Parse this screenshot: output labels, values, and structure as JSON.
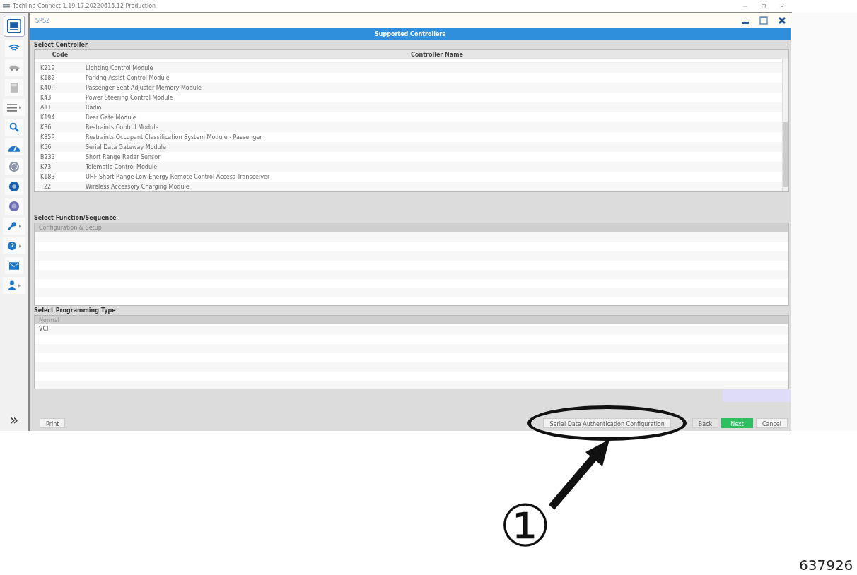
{
  "window": {
    "title": "Techline Connect 1.19.17.20220615.12 Production"
  },
  "app": {
    "title": "SPS2",
    "banner": "Supported Controllers"
  },
  "sidebar": {
    "items": [
      {
        "kind": "logo"
      },
      {
        "kind": "wifi",
        "menu": false
      },
      {
        "kind": "car",
        "menu": false
      },
      {
        "kind": "device",
        "menu": false
      },
      {
        "kind": "list",
        "menu": true
      },
      {
        "kind": "search",
        "menu": false
      },
      {
        "kind": "gauge",
        "menu": false
      },
      {
        "kind": "globe",
        "menu": false
      },
      {
        "kind": "si",
        "menu": false
      },
      {
        "kind": "disc",
        "menu": false
      },
      {
        "kind": "wrench",
        "menu": true
      },
      {
        "kind": "help",
        "menu": true
      },
      {
        "kind": "mail",
        "menu": false
      },
      {
        "kind": "user",
        "menu": true
      }
    ],
    "expand": "»"
  },
  "controllers": {
    "label": "Select Controller",
    "columns": [
      "Code",
      "Controller Name"
    ],
    "rows": [
      {
        "code": "K219",
        "name": "Lighting Control Module"
      },
      {
        "code": "K182",
        "name": "Parking Assist Control Module"
      },
      {
        "code": "K40P",
        "name": "Passenger Seat Adjuster Memory Module"
      },
      {
        "code": "K43",
        "name": "Power Steering Control Module"
      },
      {
        "code": "A11",
        "name": "Radio"
      },
      {
        "code": "K194",
        "name": "Rear Gate Module"
      },
      {
        "code": "K36",
        "name": "Restraints Control Module"
      },
      {
        "code": "K85P",
        "name": "Restraints Occupant Classification System Module - Passenger"
      },
      {
        "code": "K56",
        "name": "Serial Data Gateway Module"
      },
      {
        "code": "B233",
        "name": "Short Range Radar Sensor"
      },
      {
        "code": "K73",
        "name": "Telematic Control Module"
      },
      {
        "code": "K183",
        "name": "UHF Short Range Low Energy Remote Control Access Transceiver"
      },
      {
        "code": "T22",
        "name": "Wireless Accessory Charging Module"
      }
    ]
  },
  "functions": {
    "label": "Select Function/Sequence",
    "header": "Configuration & Setup"
  },
  "programming": {
    "label": "Select Programming Type",
    "header": "Normal",
    "rows": [
      "VCI"
    ]
  },
  "buttons": {
    "print": "Print",
    "sdac": "Serial Data Authentication Configuration",
    "back": "Back",
    "next": "Next",
    "cancel": "Cancel"
  },
  "annotation": {
    "marker": "①",
    "caption": "637926"
  }
}
